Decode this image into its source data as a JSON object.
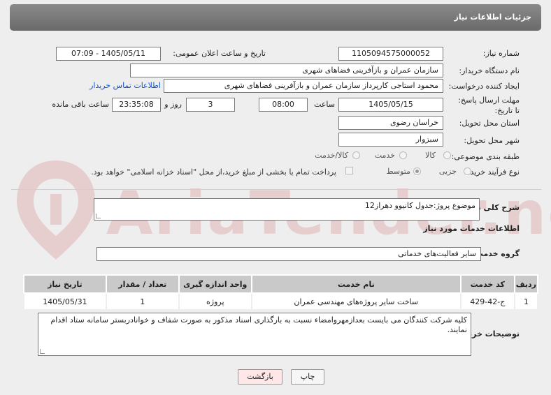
{
  "header": {
    "title": "جزئیات اطلاعات نیاز"
  },
  "watermark": {
    "text": "AriaTender.neT"
  },
  "form": {
    "need_number_label": "شماره نیاز:",
    "need_number": "1105094575000052",
    "announce_label": "تاریخ و ساعت اعلان عمومی:",
    "announce_value": "1405/05/11 - 07:09",
    "buyer_org_label": "نام دستگاه خریدار:",
    "buyer_org": "سازمان عمران و بازآفرینی فضاهای شهری",
    "requester_label": "ایجاد کننده درخواست:",
    "requester": "محمود استاجی کارپرداز سازمان عمران و بازآفرینی فضاهای شهری",
    "contact_link": "اطلاعات تماس خریدار",
    "deadline_label": "مهلت ارسال پاسخ: تا تاریخ:",
    "deadline_date": "1405/05/15",
    "time_label": "ساعت",
    "deadline_time": "08:00",
    "days_value": "3",
    "days_label": "روز و",
    "remaining_time": "23:35:08",
    "remaining_label": "ساعت باقی مانده",
    "province_label": "استان محل تحویل:",
    "province": "خراسان رضوی",
    "city_label": "شهر محل تحویل:",
    "city": "سبزوار",
    "category_label": "طبقه بندی موضوعی:",
    "category_options": [
      "کالا",
      "خدمت",
      "کالا/خدمت"
    ],
    "process_label": "نوع فرآیند خرید :",
    "process_options": [
      "جزیی",
      "متوسط"
    ],
    "payment_note": "پرداخت تمام یا بخشی از مبلغ خرید،از محل \"اسناد خزانه اسلامی\" خواهد بود."
  },
  "summary": {
    "label": "شرح کلی نیاز:",
    "text": "موضوع پروژ:جدول کانیوو دهراز12"
  },
  "services_title": "اطلاعات خدمات مورد نیاز",
  "service_group": {
    "label": "گروه خدمت:",
    "value": "سایر فعالیت‌های خدماتی"
  },
  "table": {
    "headers": [
      "ردیف",
      "کد خدمت",
      "نام خدمت",
      "واحد اندازه گیری",
      "تعداد / مقدار",
      "تاریخ نیاز"
    ],
    "rows": [
      [
        "1",
        "ج-42-429",
        "ساخت سایر پروژه‌های مهندسی عمران",
        "پروژه",
        "1",
        "1405/05/31"
      ]
    ]
  },
  "buyer_notes": {
    "label": "توضیحات خریدار:",
    "text": "کلیه شرکت کنندگان می بایست بعدازمهروامضاء نسبت به بارگذاری اسناد مذکور به صورت شفاف و خوانادربستر سامانه ستاد اقدام نمایند."
  },
  "buttons": {
    "print": "چاپ",
    "back": "بازگشت"
  }
}
